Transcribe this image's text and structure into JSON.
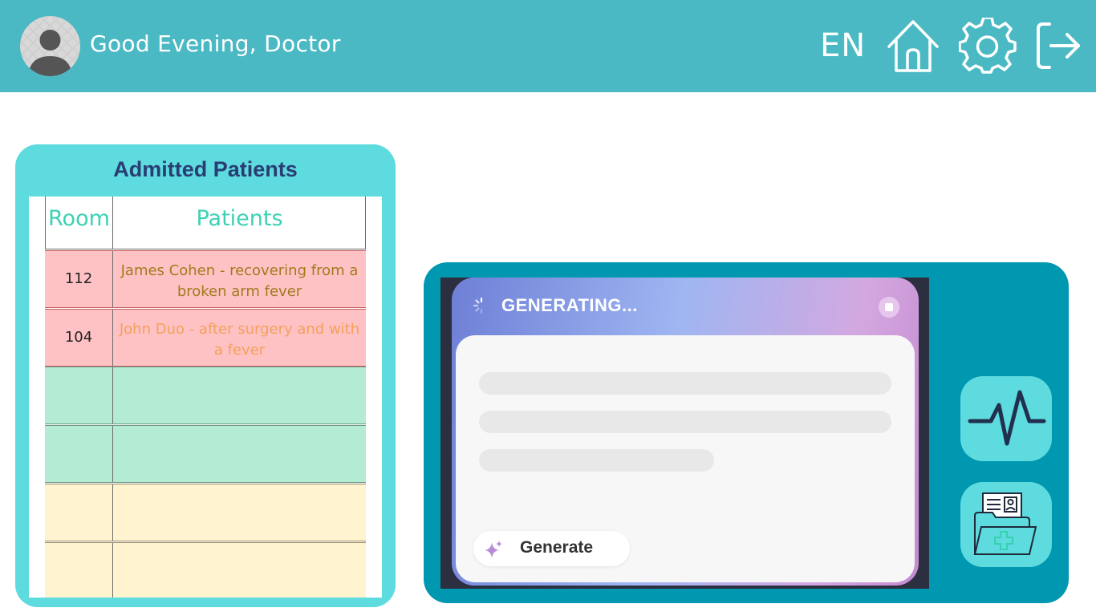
{
  "header": {
    "greeting": "Good Evening, Doctor",
    "language": "EN",
    "background": "#4bb9c4",
    "icons": [
      "avatar",
      "home-icon",
      "settings-gear-icon",
      "logout-icon"
    ]
  },
  "patients": {
    "title": "Admitted Patients",
    "columns": {
      "room": "Room",
      "patients": "Patients"
    },
    "rows": [
      {
        "room": "112",
        "patient": "James Cohen - recovering from a broken arm fever",
        "status": "red",
        "text_color": "#a07a1e"
      },
      {
        "room": "104",
        "patient": "John Duo - after surgery and with a fever",
        "status": "red",
        "text_color": "#f3a05a"
      },
      {
        "room": "",
        "patient": "",
        "status": "green"
      },
      {
        "room": "",
        "patient": "",
        "status": "green"
      },
      {
        "room": "",
        "patient": "",
        "status": "yellow"
      },
      {
        "room": "",
        "patient": "",
        "status": "yellow"
      }
    ]
  },
  "ai": {
    "status": "GENERATING...",
    "generate_label": "Generate",
    "side_buttons": [
      "vitals-pulse-icon",
      "medical-records-folder-icon"
    ]
  },
  "colors": {
    "accent": "#5ddbdf",
    "panel": "#0097b0",
    "title_navy": "#2a3d73",
    "header_teal": "#3cd1b4"
  }
}
